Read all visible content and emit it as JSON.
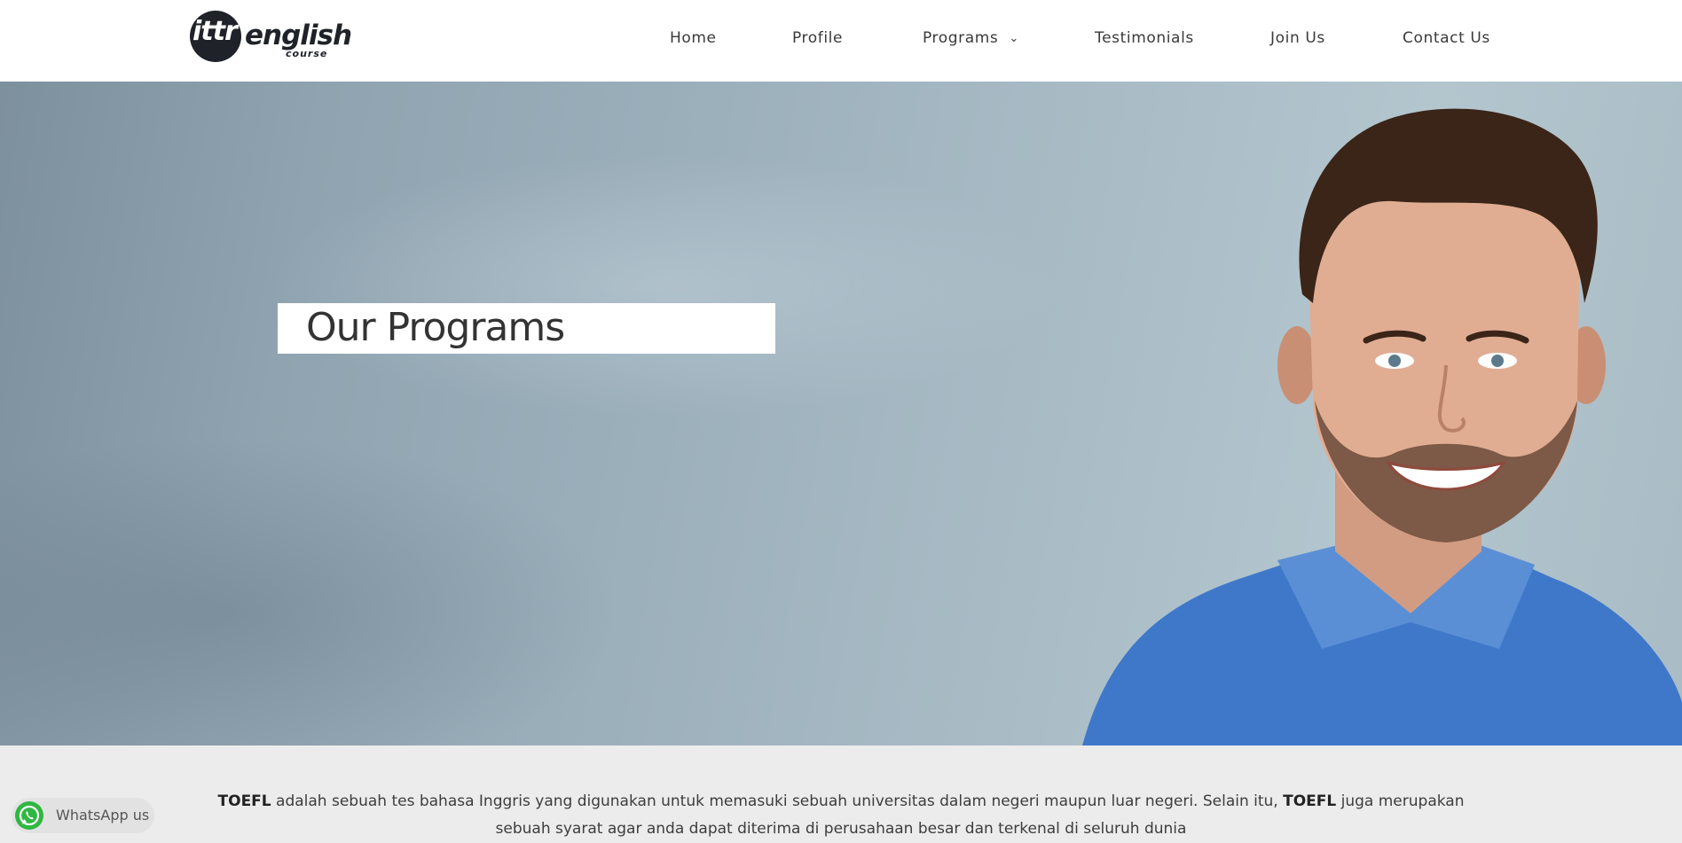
{
  "header": {
    "logo": {
      "mark": "ittr",
      "word": "english",
      "sub": "course"
    },
    "nav": [
      {
        "label": "Home"
      },
      {
        "label": "Profile"
      },
      {
        "label": "Programs",
        "icon": "chevron-down-icon"
      },
      {
        "label": "Testimonials"
      },
      {
        "label": "Join Us"
      },
      {
        "label": "Contact Us"
      }
    ]
  },
  "hero": {
    "title": "Our Programs"
  },
  "content": {
    "intro": {
      "term": "TOEFL",
      "part1": " adalah sebuah tes bahasa Inggris yang digunakan untuk memasuki sebuah universitas dalam negeri maupun luar negeri. Selain itu, ",
      "term2": "TOEFL",
      "part2": " juga merupakan sebuah syarat agar anda dapat diterima di perusahaan besar dan terkenal di seluruh dunia"
    }
  },
  "whatsapp": {
    "label": "WhatsApp us",
    "icon": "whatsapp-icon",
    "color": "#2fb742"
  }
}
